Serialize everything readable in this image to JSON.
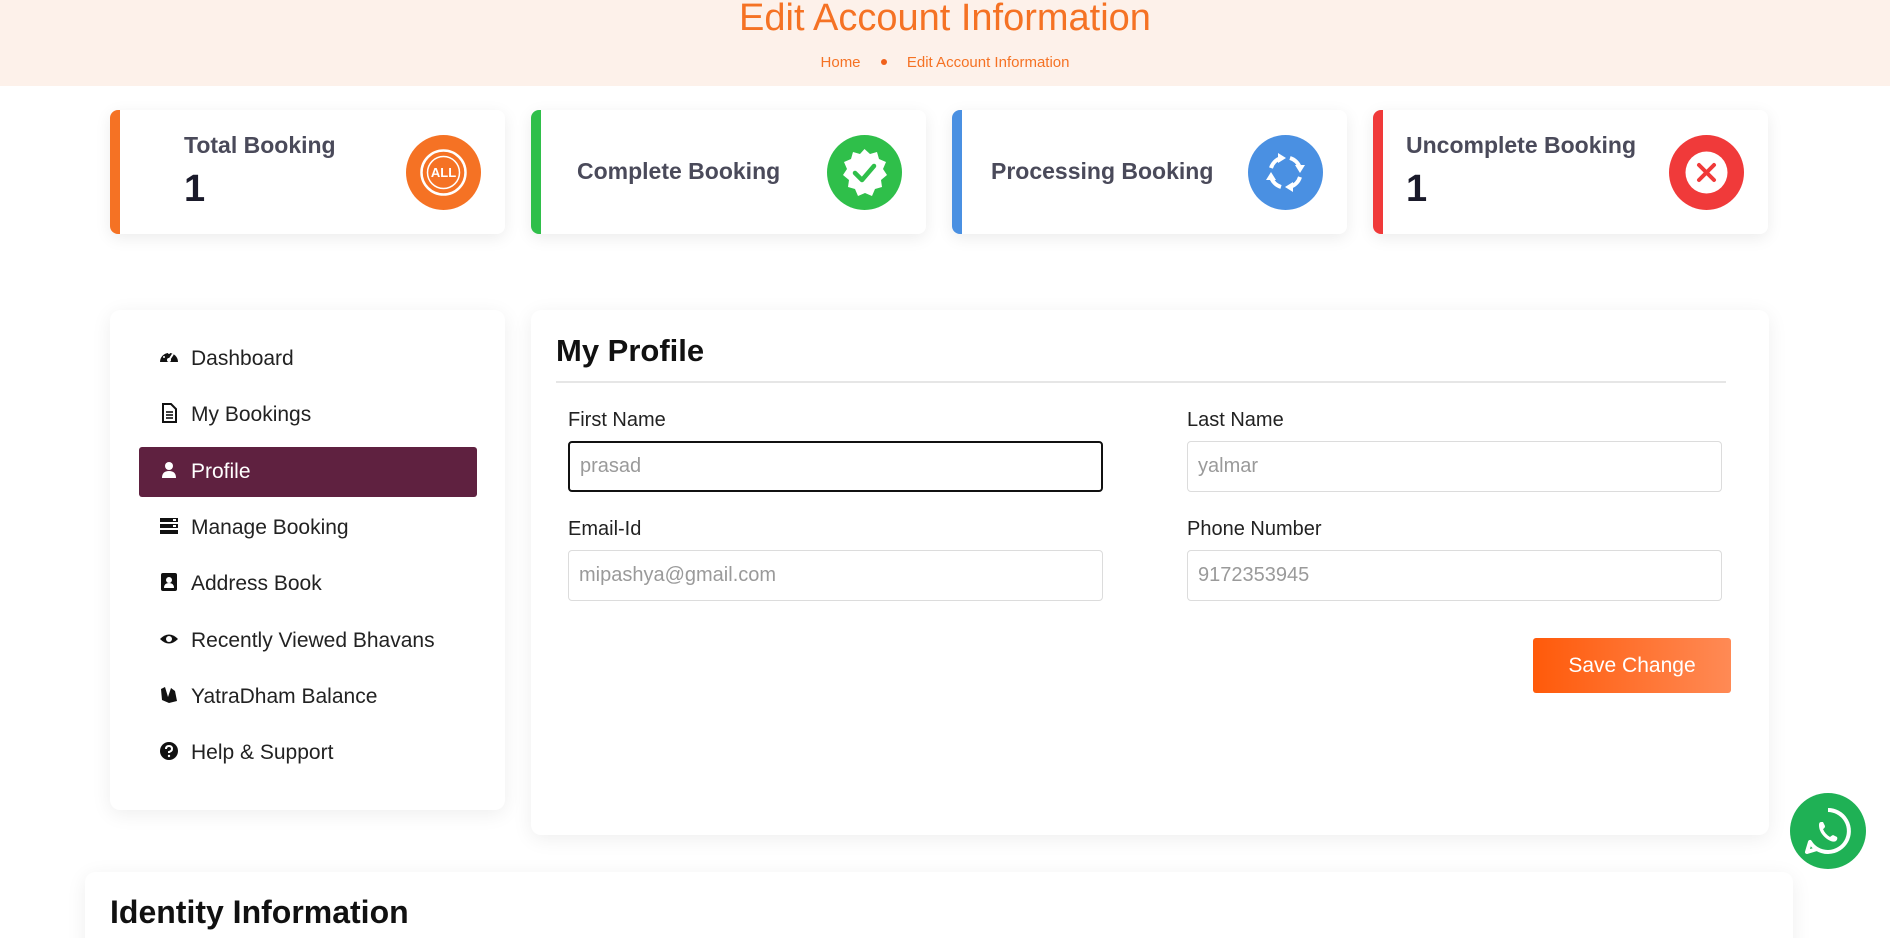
{
  "header": {
    "title": "Edit Account Information",
    "breadcrumb": {
      "home": "Home",
      "current": "Edit Account Information"
    }
  },
  "stats": [
    {
      "label": "Total Booking",
      "value": "1",
      "color": "#f57224",
      "icon": "all-badge-icon",
      "icon_text": "ALL"
    },
    {
      "label": "Complete Booking",
      "value": "",
      "color": "#2fbf4a",
      "icon": "check-badge-icon"
    },
    {
      "label": "Processing Booking",
      "value": "",
      "color": "#4a90e2",
      "icon": "refresh-arrows-icon"
    },
    {
      "label": "Uncomplete Booking",
      "value": "1",
      "color": "#f03a3a",
      "icon": "x-circle-icon"
    }
  ],
  "sidebar": {
    "items": [
      {
        "label": "Dashboard",
        "icon": "gauge-icon"
      },
      {
        "label": "My Bookings",
        "icon": "document-icon"
      },
      {
        "label": "Profile",
        "icon": "user-icon",
        "active": true
      },
      {
        "label": "Manage Booking",
        "icon": "server-icon"
      },
      {
        "label": "Address Book",
        "icon": "address-book-icon"
      },
      {
        "label": "Recently Viewed Bhavans",
        "icon": "eye-icon"
      },
      {
        "label": "YatraDham Balance",
        "icon": "wallet-icon"
      },
      {
        "label": "Help & Support",
        "icon": "question-circle-icon"
      }
    ],
    "active_color": "#5f2140"
  },
  "profile": {
    "title": "My Profile",
    "fields": {
      "first_name": {
        "label": "First Name",
        "placeholder": "prasad"
      },
      "last_name": {
        "label": "Last Name",
        "placeholder": "yalmar"
      },
      "email": {
        "label": "Email-Id",
        "placeholder": "mipashya@gmail.com"
      },
      "phone": {
        "label": "Phone Number",
        "placeholder": "9172353945"
      }
    },
    "save_label": "Save Change"
  },
  "identity": {
    "title": "Identity Information"
  },
  "whatsapp": {
    "icon": "whatsapp-icon"
  }
}
